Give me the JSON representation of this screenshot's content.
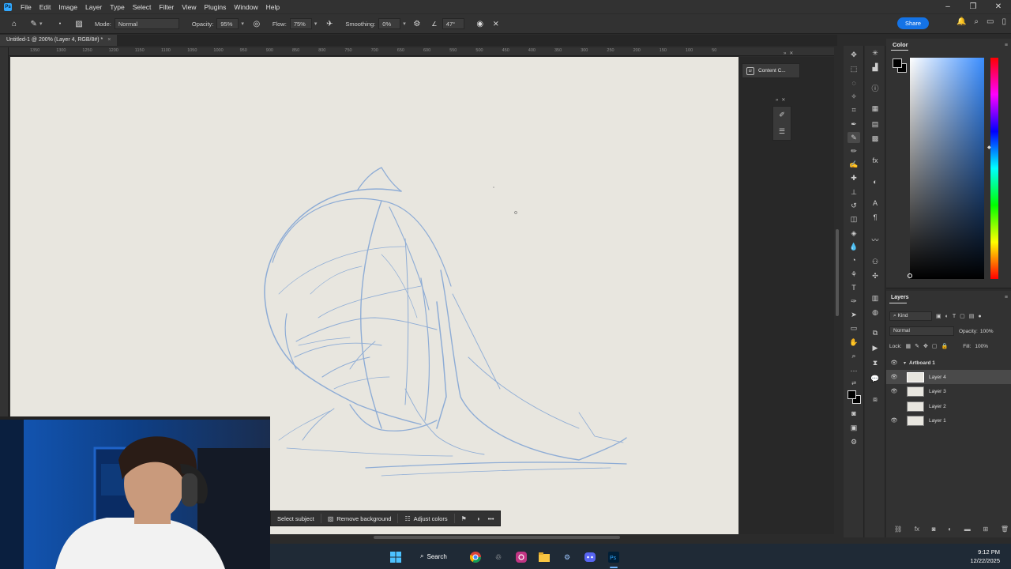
{
  "app": {
    "menu": [
      "File",
      "Edit",
      "Image",
      "Layer",
      "Type",
      "Select",
      "Filter",
      "View",
      "Plugins",
      "Window",
      "Help"
    ],
    "window_controls": [
      "–",
      "❐",
      "✕"
    ]
  },
  "options_bar": {
    "mode_label": "Mode:",
    "mode_value": "Normal",
    "opacity_label": "Opacity:",
    "opacity_value": "95%",
    "flow_label": "Flow:",
    "flow_value": "75%",
    "smoothing_label": "Smoothing:",
    "smoothing_value": "0%",
    "angle_value": "47°",
    "share_label": "Share"
  },
  "document": {
    "tab_title": "Untitled-1 @ 200% (Layer 4, RGB/8#) *",
    "close": "×"
  },
  "ruler": {
    "labels": [
      "1350",
      "1300",
      "1250",
      "1200",
      "1150",
      "1100",
      "1050",
      "1000",
      "950",
      "900",
      "850",
      "800",
      "750",
      "700",
      "650",
      "600",
      "550",
      "500",
      "450",
      "400",
      "350",
      "300",
      "250",
      "200",
      "150",
      "100",
      "50"
    ]
  },
  "floating": {
    "content_credentials": "Content C...",
    "content_credentials_icon": "cr"
  },
  "color_panel": {
    "title": "Color",
    "accent": "#3a8dff"
  },
  "layers_panel": {
    "title": "Layers",
    "kind_label": "Kind",
    "blend_mode": "Normal",
    "opacity_label": "Opacity:",
    "opacity_value": "100%",
    "lock_label": "Lock:",
    "fill_label": "Fill:",
    "fill_value": "100%",
    "artboard": "Artboard 1",
    "layers": [
      {
        "name": "Layer 4",
        "visible": true,
        "selected": true
      },
      {
        "name": "Layer 3",
        "visible": true,
        "selected": false
      },
      {
        "name": "Layer 2",
        "visible": false,
        "selected": false
      },
      {
        "name": "Layer 1",
        "visible": true,
        "selected": false
      }
    ]
  },
  "contextual_bar": {
    "select_subject": "Select subject",
    "remove_background": "Remove background",
    "adjust_colors": "Adjust colors",
    "more": "•••"
  },
  "taskbar": {
    "search_label": "Search",
    "time": "9:12 PM",
    "date": "12/22/2025"
  },
  "colors": {
    "canvas": "#e8e6df",
    "sketch_stroke": "#7fa3d4",
    "panel_bg": "#323232",
    "share_blue": "#1473e6"
  }
}
